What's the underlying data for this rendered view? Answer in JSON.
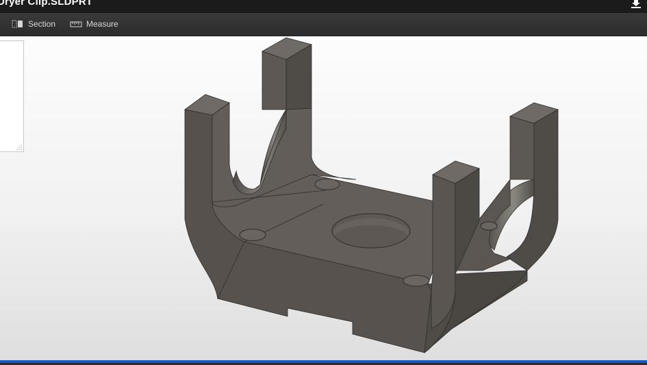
{
  "window": {
    "title": "Dryer Clip.SLDPRT"
  },
  "toolbar": {
    "section_label": "Section",
    "measure_label": "Measure",
    "section_icon": "section-icon",
    "measure_icon": "ruler-icon",
    "download_icon": "download-icon"
  },
  "colors": {
    "title_bar": "#1b1b1b",
    "toolbar": "#333333",
    "viewport_top": "#fdfdfd",
    "viewport_bottom": "#dedede",
    "model": "#5c5752",
    "accent_bar": "#1a56c4"
  }
}
